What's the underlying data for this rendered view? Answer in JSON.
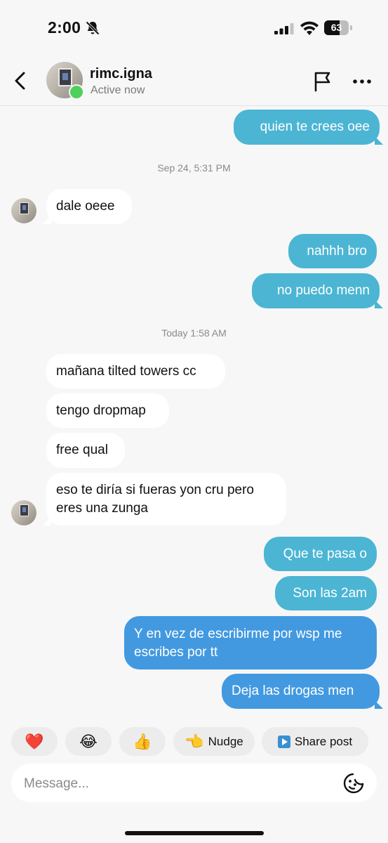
{
  "status_bar": {
    "time": "2:00",
    "battery": "63",
    "battery_level": 0.63
  },
  "header": {
    "username": "rimc.igna",
    "status": "Active now"
  },
  "messages": [
    {
      "side": "out",
      "text": "quien te crees oee"
    },
    {
      "type": "timestamp",
      "text": "Sep 24, 5:31 PM"
    },
    {
      "side": "in",
      "text": "dale oeee"
    },
    {
      "side": "out",
      "text": "nahhh bro"
    },
    {
      "side": "out",
      "text": "no puedo menn"
    },
    {
      "type": "timestamp",
      "text": "Today 1:58 AM"
    },
    {
      "side": "in",
      "text": "mañana tilted towers cc"
    },
    {
      "side": "in",
      "text": "tengo dropmap"
    },
    {
      "side": "in",
      "text": "free qual"
    },
    {
      "side": "in",
      "text": "eso te diría si fueras yon cru pero eres una zunga"
    },
    {
      "side": "out",
      "text": "Que te pasa o"
    },
    {
      "side": "out",
      "text": "Son las 2am"
    },
    {
      "side": "out",
      "text": "Y en vez de escribirme por wsp me escribes por tt"
    },
    {
      "side": "out",
      "text": "Deja las drogas men"
    }
  ],
  "quick_replies": [
    {
      "emoji": "❤️"
    },
    {
      "emoji": "😂"
    },
    {
      "emoji": "👍"
    },
    {
      "emoji": "👈",
      "label": "Nudge"
    },
    {
      "label": "Share post"
    }
  ],
  "composer": {
    "placeholder": "Message..."
  },
  "colors": {
    "outgoing": "#4bb5d3",
    "outgoing_dark": "#4299e0",
    "incoming": "#ffffff",
    "online": "#4fcf5b"
  }
}
